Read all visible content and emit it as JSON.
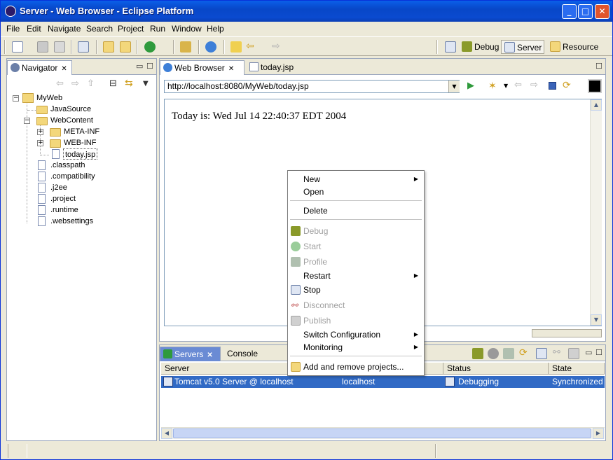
{
  "window": {
    "title": "Server - Web Browser - Eclipse Platform",
    "min": "_",
    "max": "□",
    "close": "✕"
  },
  "menu": [
    "File",
    "Edit",
    "Navigate",
    "Search",
    "Project",
    "Run",
    "Window",
    "Help"
  ],
  "perspectives": {
    "debug": "Debug",
    "server": "Server",
    "resource": "Resource"
  },
  "navigator": {
    "tab": "Navigator",
    "close": "✕",
    "tree": {
      "project": "MyWeb",
      "javasource": "JavaSource",
      "webcontent": "WebContent",
      "metainf": "META-INF",
      "webinf": "WEB-INF",
      "todayjsp": "today.jsp",
      "classpath": ".classpath",
      "compat": ".compatibility",
      "j2ee": ".j2ee",
      "project_file": ".project",
      "runtime": ".runtime",
      "websettings": ".websettings"
    }
  },
  "editor": {
    "tab_browser": "Web Browser",
    "tab_close": "✕",
    "tab_jsp": "today.jsp",
    "url": "http://localhost:8080/MyWeb/today.jsp",
    "page_text": "Today is: Wed Jul 14 22:40:37 EDT 2004"
  },
  "context_menu": {
    "new": "New",
    "open": "Open",
    "delete": "Delete",
    "debug": "Debug",
    "start": "Start",
    "profile": "Profile",
    "restart": "Restart",
    "stop": "Stop",
    "disconnect": "Disconnect",
    "publish": "Publish",
    "switch": "Switch Configuration",
    "monitoring": "Monitoring",
    "add_remove": "Add and remove projects..."
  },
  "servers": {
    "tab": "Servers",
    "close": "✕",
    "console_tab": "Console",
    "headers": {
      "server": "Server",
      "status": "Status",
      "state": "State"
    },
    "row": {
      "server": "Tomcat v5.0 Server @ localhost",
      "host": "localhost",
      "status": "Debugging",
      "state": "Synchronized"
    }
  },
  "icons": {
    "app": "eclipse-icon",
    "arrow": "▼",
    "play": "▶"
  }
}
